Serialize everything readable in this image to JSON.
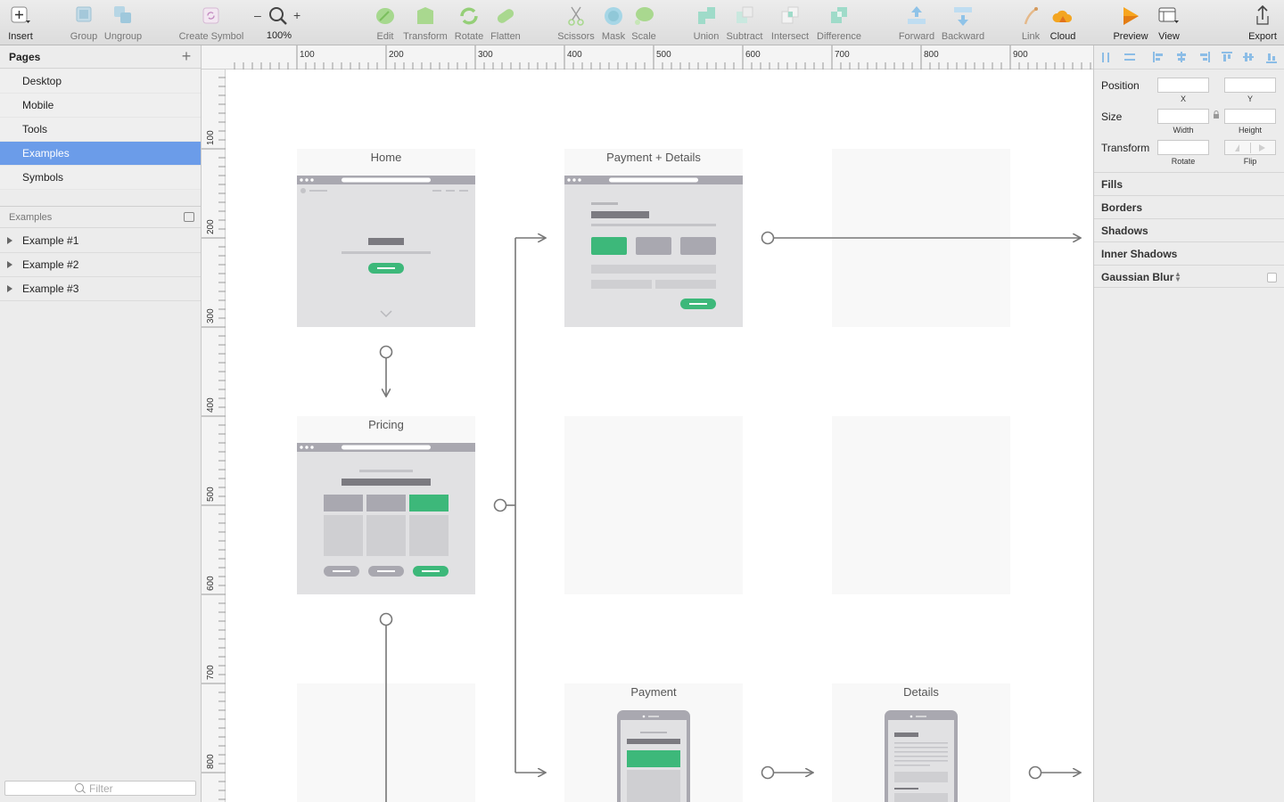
{
  "toolbar": {
    "insert": "Insert",
    "group": "Group",
    "ungroup": "Ungroup",
    "create_symbol": "Create Symbol",
    "zoom": "100%",
    "edit": "Edit",
    "transform": "Transform",
    "rotate": "Rotate",
    "flatten": "Flatten",
    "scissors": "Scissors",
    "mask": "Mask",
    "scale": "Scale",
    "union": "Union",
    "subtract": "Subtract",
    "intersect": "Intersect",
    "difference": "Difference",
    "forward": "Forward",
    "backward": "Backward",
    "link": "Link",
    "cloud": "Cloud",
    "preview": "Preview",
    "view": "View",
    "export": "Export"
  },
  "pages": {
    "title": "Pages",
    "add_symbol": "+",
    "items": [
      "Desktop",
      "Mobile",
      "Tools",
      "Examples",
      "Symbols"
    ],
    "active": "Examples"
  },
  "layers": {
    "title": "Examples",
    "items": [
      "Example #1",
      "Example #2",
      "Example #3"
    ]
  },
  "filter": {
    "placeholder": "Filter"
  },
  "rulers": {
    "top": [
      "100",
      "200",
      "300",
      "400",
      "500",
      "600",
      "700",
      "800",
      "900"
    ],
    "left": [
      "100",
      "200",
      "300",
      "400",
      "500",
      "600",
      "700",
      "800"
    ]
  },
  "canvas": {
    "artboards": [
      "Home",
      "Payment + Details",
      "Pricing",
      "Payment",
      "Details"
    ]
  },
  "inspector": {
    "position": "Position",
    "x": "X",
    "y": "Y",
    "size": "Size",
    "width": "Width",
    "height": "Height",
    "transform": "Transform",
    "rotate": "Rotate",
    "flip": "Flip",
    "sections": [
      "Fills",
      "Borders",
      "Shadows",
      "Inner Shadows",
      "Gaussian Blur"
    ]
  },
  "colors": {
    "accent_selection": "#6b9ce9",
    "wire_green": "#3db87a",
    "wire_gray": "#a9a8b0",
    "connector": "#777777"
  }
}
